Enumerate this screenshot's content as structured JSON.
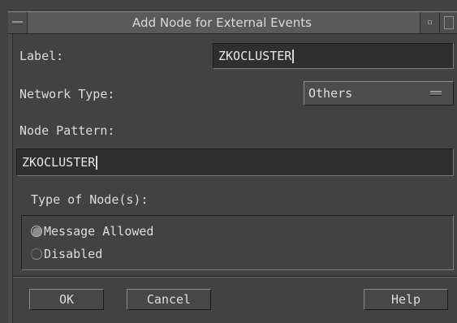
{
  "window": {
    "title": "Add Node for External Events"
  },
  "label_field": {
    "label": "Label:",
    "value": "ZKOCLUSTER"
  },
  "network_type": {
    "label": "Network Type:",
    "selected": "Others"
  },
  "node_pattern": {
    "label": "Node Pattern:",
    "value": "ZKOCLUSTER"
  },
  "node_type": {
    "label": "Type of Node(s):",
    "options": [
      {
        "label": "Message Allowed",
        "selected": true
      },
      {
        "label": "Disabled",
        "selected": false
      }
    ]
  },
  "buttons": {
    "ok": "OK",
    "cancel": "Cancel",
    "help": "Help"
  },
  "icons": {
    "window_menu": "window-menu-icon",
    "minimize": "minimize-icon",
    "maximize": "maximize-icon",
    "option_indicator": "option-menu-indicator-icon"
  },
  "colors": {
    "background": "#424242",
    "field": "#2f2f2f",
    "text": "#e2e2e2"
  }
}
